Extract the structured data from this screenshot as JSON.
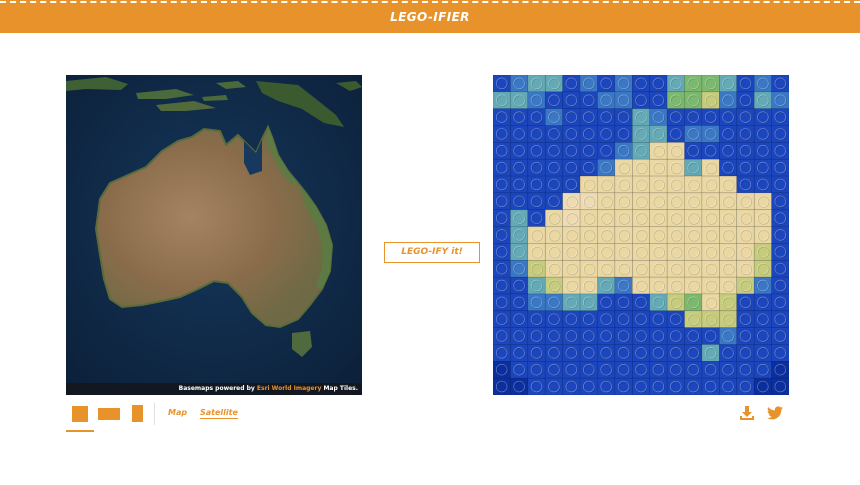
{
  "header": {
    "title": "LEGO-IFIER"
  },
  "map": {
    "attribution_prefix": "Basemaps powered by ",
    "attribution_link": "Esri World Imagery",
    "attribution_suffix": " Map Tiles."
  },
  "controls": {
    "shape_buttons": [
      {
        "name": "square",
        "selected": true
      },
      {
        "name": "landscape",
        "selected": false
      },
      {
        "name": "portrait",
        "selected": false
      }
    ],
    "map_label": "Map",
    "satellite_label": "Satellite",
    "active_basemap": "Satellite"
  },
  "action": {
    "legoify_label": "LEGO-IFY it!"
  },
  "lego": {
    "cols": 17,
    "rows": 19,
    "palette": {
      "D": "#0b2f9e",
      "B": "#1c46bd",
      "L": "#3a78c6",
      "T": "#63aab6",
      "G": "#7bb96e",
      "Y": "#c6cc7c",
      "S": "#ead7a2",
      "W": "#efdbb1"
    },
    "grid": [
      "BLTTBLBLBBTGGTBLB",
      "TTLBBBLLBBGGYLBTL",
      "BBBLBBBBTLBBBBBBB",
      "BBBBBBBBTTBLLBBBB",
      "BBBBBBBLTSSBBBBBB",
      "BBBBBBLSSSSTSBBBB",
      "BBBBBSSSSSSSSSBBB",
      "BBBBWWSSSSSSSSSSB",
      "BTBSWSSSSSSSSSSSB",
      "BTSSSSSSSSSSSSSSB",
      "BTSSSSSSSSSSSSSYB",
      "BLYSSSSSSSSSSSSYB",
      "BBTYSSTLSSSSSSYLB",
      "BBLLTTBBBTYGSYBBB",
      "BBBBBBBBBBBYYYBBB",
      "BBBBBBBBBBBBBLBBB",
      "BBBBBBBBBBBBTBBBB",
      "DBBBBBBBBBBBBBBBD",
      "DDBBBBBBBBBBBBBDD"
    ]
  },
  "icons": {
    "download": "download-icon",
    "twitter": "twitter-icon"
  },
  "colors": {
    "accent": "#e8922c",
    "ocean": "#0f2a47",
    "land": "#8d6f4e"
  }
}
